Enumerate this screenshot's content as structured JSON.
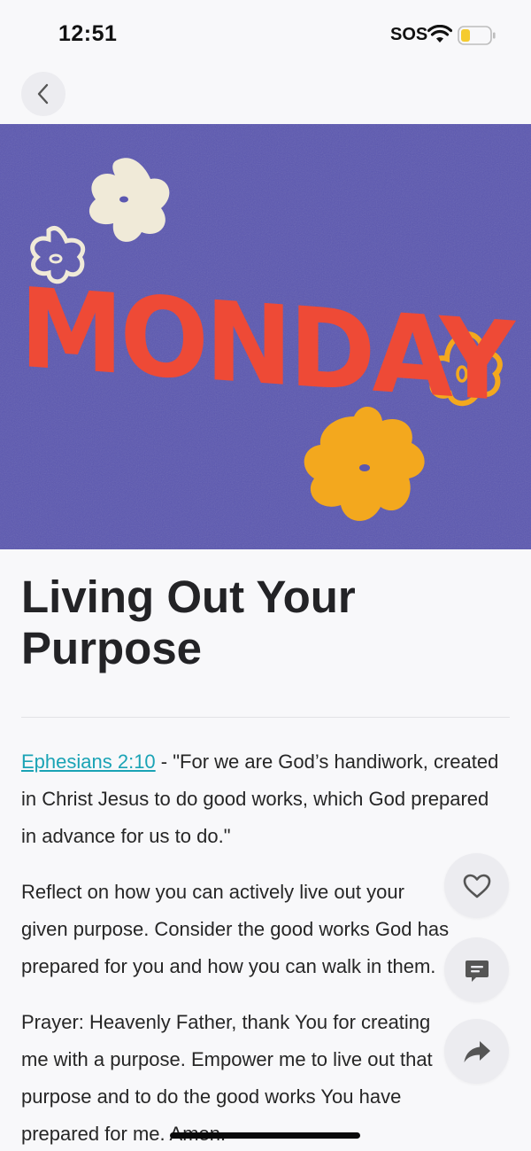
{
  "status_bar": {
    "time": "12:51",
    "sos": "SOS",
    "icons": [
      "wifi-icon",
      "battery-icon"
    ],
    "battery_color": "#f5cb2f"
  },
  "nav": {
    "back_icon": "chevron-left-icon"
  },
  "hero": {
    "text": "MONDAY",
    "colors": {
      "background": "#5b57b0",
      "text": "#ee4a36",
      "flower_cream": "#f0ead8",
      "flower_yellow": "#f3a81e"
    }
  },
  "devotional": {
    "title": "Living Out Your Purpose",
    "scripture_ref": "Ephesians 2:10",
    "scripture_text": " - \"For we are God’s handiwork, created in Christ Jesus to do good works, which God prepared in advance for us to do.\"",
    "paragraph_2_lines": [
      "Reflect on how you can actively live out your",
      "given purpose. Consider the good works God has",
      "prepared for you and how you can walk in them."
    ],
    "paragraph_3_lines": [
      "Prayer: Heavenly Father, thank You for creating",
      "me with a purpose. Empower me to live out that",
      "purpose and to do the good works You have",
      "prepared for me. Amen."
    ],
    "link_color": "#1aa3b5"
  },
  "actions": {
    "like_icon": "heart-icon",
    "comment_icon": "comment-icon",
    "share_icon": "share-icon"
  }
}
